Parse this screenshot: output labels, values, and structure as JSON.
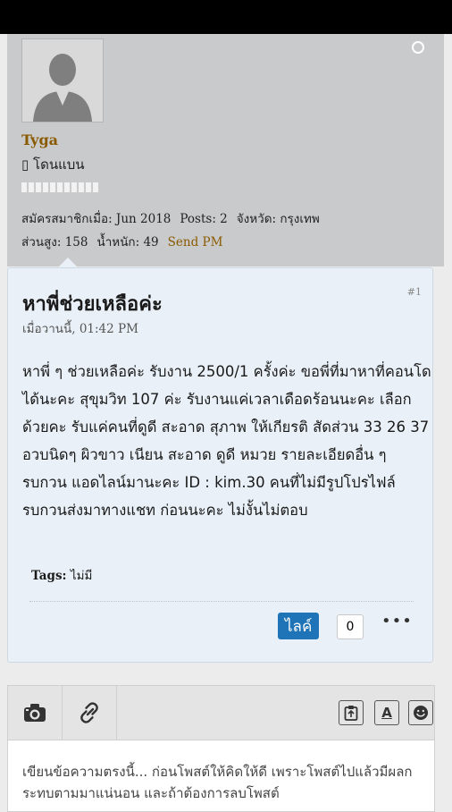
{
  "user": {
    "name": "Tyga",
    "title": "▯ โดนแบน",
    "joined": "สมัครสมาชิกเมื่อ: Jun 2018",
    "posts": "Posts: 2",
    "province": "จังหวัด: กรุงเทพ",
    "height": "ส่วนสูง: 158",
    "weight": "น้ำหนัก: 49",
    "send_pm": "Send PM"
  },
  "post": {
    "number": "#1",
    "title": "หาพี่ช่วยเหลือค่ะ",
    "date": "เมื่อวานนี้, 01:42 PM",
    "body": "หาพี่ ๆ ช่วยเหลือค่ะ รับงาน 2500/1 ครั้งค่ะ ขอพี่ที่มาหาที่คอนโดได้นะคะ สุขุมวิท 107 ค่ะ รับงานแค่เวลาเดือดร้อนนะคะ เลือกด้วยคะ รับแค่คนที่ดูดี สะอาด สุภาพ ให้เกียรติ สัดส่วน 33 26 37 อวบนิดๆ ผิวขาว เนียน สะอาด ดูดี หมวย รายละเอียดอื่น ๆ รบกวน แอดไลน์มานะคะ ID : kim.30 คนที่ไม่มีรูปโปรไฟล์ รบกวนส่งมาทางแชท ก่อนนะคะ ไม่งั้นไม่ตอบ",
    "tags_label": "Tags:",
    "tags_value": "ไม่มี",
    "like_label": "ไลค์",
    "like_count": "0",
    "more": "•••"
  },
  "editor": {
    "font_button": "A",
    "placeholder": "เขียนข้อความตรงนี้... ก่อนโพสต์ให้คิดให้ดี เพราะโพสต์ไปแล้วมีผลกระทบตามมาแน่นอน และถ้าต้องการลบโพสต์"
  },
  "icons": {
    "status": "online-status-icon",
    "camera": "camera-icon",
    "link": "link-icon",
    "paste": "clipboard-icon",
    "font": "font-icon",
    "emoji": "smiley-icon"
  },
  "colors": {
    "accent": "#1f73b7",
    "username": "#8a5a00",
    "post_bg": "#e9f0f7",
    "userblock_bg": "#c9cacb"
  }
}
